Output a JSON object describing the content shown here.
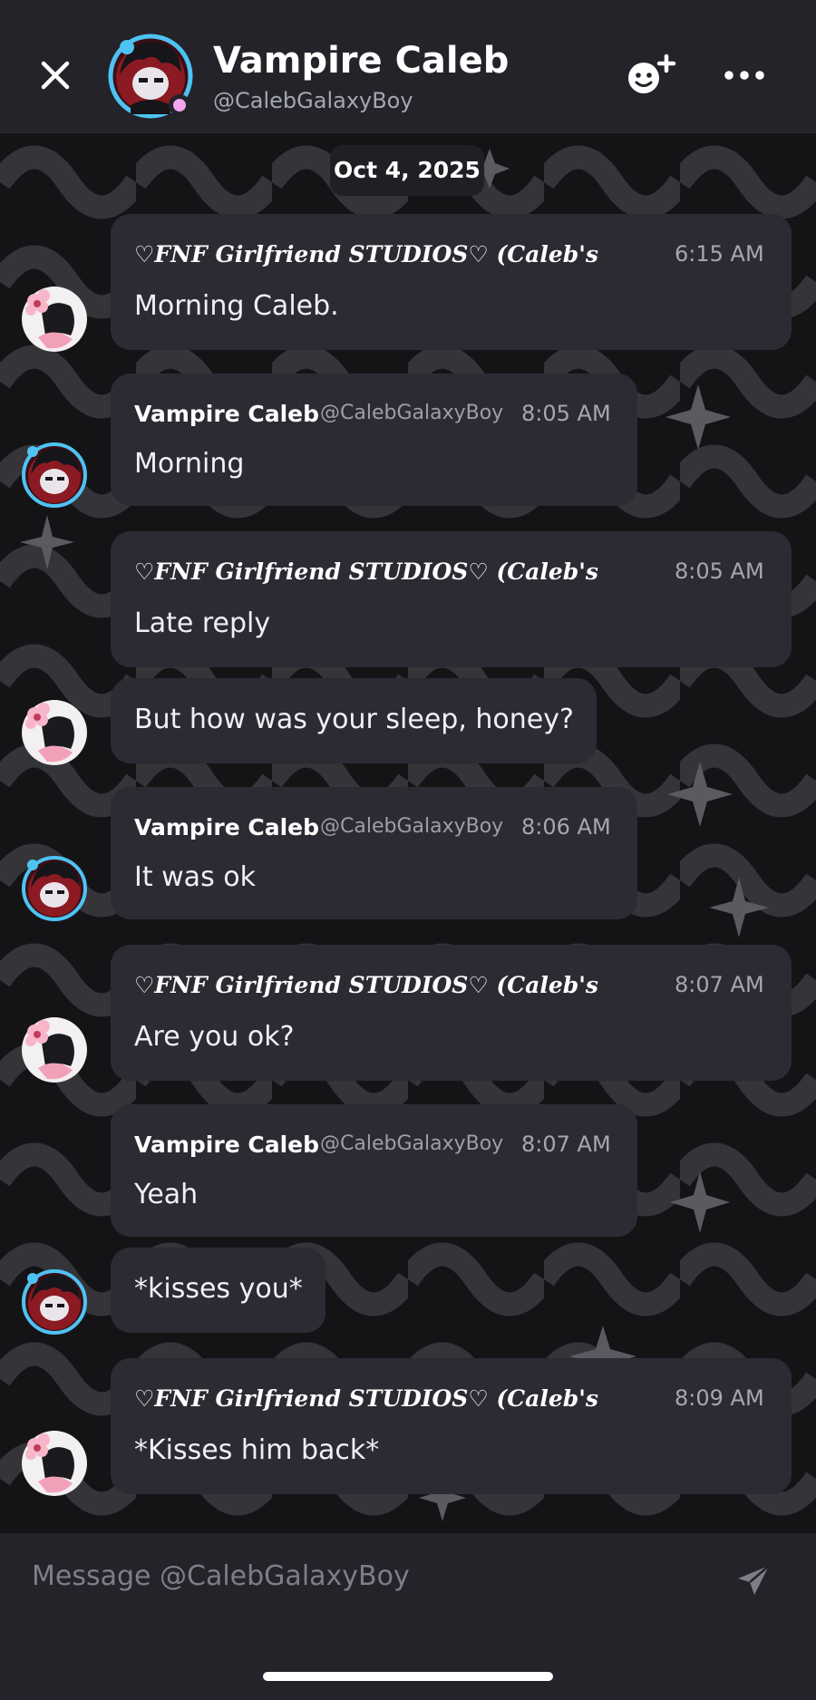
{
  "header": {
    "name": "Vampire Caleb",
    "handle": "@CalebGalaxyBoy"
  },
  "date_separator": "Oct 4, 2025",
  "messages": [
    {
      "name": "♡𝑭𝑵𝑭 𝑮𝒊𝒓𝒍𝒇𝒓𝒊𝒆𝒏𝒅 𝑺𝑻𝑼𝑫𝑰𝑶𝑺♡ (Caleb's",
      "handle": "",
      "time": "6:15 AM",
      "text": "Morning Caleb."
    },
    {
      "name": "Vampire Caleb",
      "handle": "@CalebGalaxyBoy",
      "time": "8:05 AM",
      "text": "Morning"
    },
    {
      "name": "♡𝑭𝑵𝑭 𝑮𝒊𝒓𝒍𝒇𝒓𝒊𝒆𝒏𝒅 𝑺𝑻𝑼𝑫𝑰𝑶𝑺♡ (Caleb's",
      "handle": "",
      "time": "8:05 AM",
      "text": "Late reply"
    },
    {
      "text": "But how was your sleep, honey?"
    },
    {
      "name": "Vampire Caleb",
      "handle": "@CalebGalaxyBoy",
      "time": "8:06 AM",
      "text": "It was ok"
    },
    {
      "name": "♡𝑭𝑵𝑭 𝑮𝒊𝒓𝒍𝒇𝒓𝒊𝒆𝒏𝒅 𝑺𝑻𝑼𝑫𝑰𝑶𝑺♡ (Caleb's",
      "handle": "",
      "time": "8:07 AM",
      "text": "Are you ok?"
    },
    {
      "name": "Vampire Caleb",
      "handle": "@CalebGalaxyBoy",
      "time": "8:07 AM",
      "text": "Yeah"
    },
    {
      "text": "*kisses you*"
    },
    {
      "name": "♡𝑭𝑵𝑭 𝑮𝒊𝒓𝒍𝒇𝒓𝒊𝒆𝒏𝒅 𝑺𝑻𝑼𝑫𝑰𝑶𝑺♡ (Caleb's",
      "handle": "",
      "time": "8:09 AM",
      "text": "*Kisses him back*"
    }
  ],
  "composer": {
    "placeholder": "Message @CalebGalaxyBoy"
  },
  "icons": {
    "close": "close-icon",
    "add_friend": "add-friend-icon",
    "more": "more-options-icon",
    "send": "send-icon"
  },
  "colors": {
    "header_bg": "#232329",
    "bubble_bg": "#2c2b34",
    "status_dot": "#f3a6f0",
    "caleb_avatar_ring": "#4ec3f2",
    "gf_avatar_accent": "#f2a0b8"
  }
}
